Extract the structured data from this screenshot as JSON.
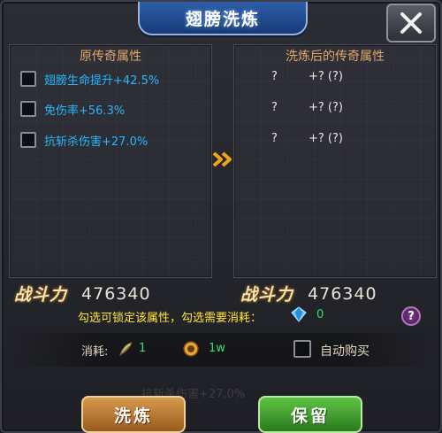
{
  "window": {
    "title": "翅膀洗炼"
  },
  "left_panel": {
    "title": "原传奇属性",
    "attributes": [
      {
        "label": "翅膀生命提升+42.5%",
        "checked": false
      },
      {
        "label": "免伤率+56.3%",
        "checked": false
      },
      {
        "label": "抗斩杀伤害+27.0%",
        "checked": false
      }
    ]
  },
  "right_panel": {
    "title": "洗炼后的传奇属性",
    "results": [
      {
        "name": "?",
        "value": "+? (?)"
      },
      {
        "name": "?",
        "value": "+? (?)"
      },
      {
        "name": "?",
        "value": "+? (?)"
      }
    ]
  },
  "power_left": {
    "label": "战斗力",
    "value": "476340"
  },
  "power_right": {
    "label": "战斗力",
    "value": "476340"
  },
  "hint": {
    "text": "勾选可锁定该属性，勾选需要消耗：",
    "diamond_count": "0",
    "help": "?"
  },
  "cost": {
    "label": "消耗:",
    "feather_count": "1",
    "coin_count": "1w",
    "auto_buy_label": "自动购买",
    "auto_buy_checked": false
  },
  "ghost": {
    "text": "抗斩杀伤害+27.0%"
  },
  "buttons": {
    "wash": "洗炼",
    "keep": "保留"
  },
  "colors": {
    "accent_blue": "#28b7ff",
    "hint_yellow": "#ffe53b",
    "count_green": "#32e06a",
    "panel_title": "#e0a86a"
  },
  "icons": [
    "close-icon",
    "arrow-right-icon",
    "diamond-icon",
    "feather-icon",
    "coin-icon",
    "help-icon"
  ]
}
